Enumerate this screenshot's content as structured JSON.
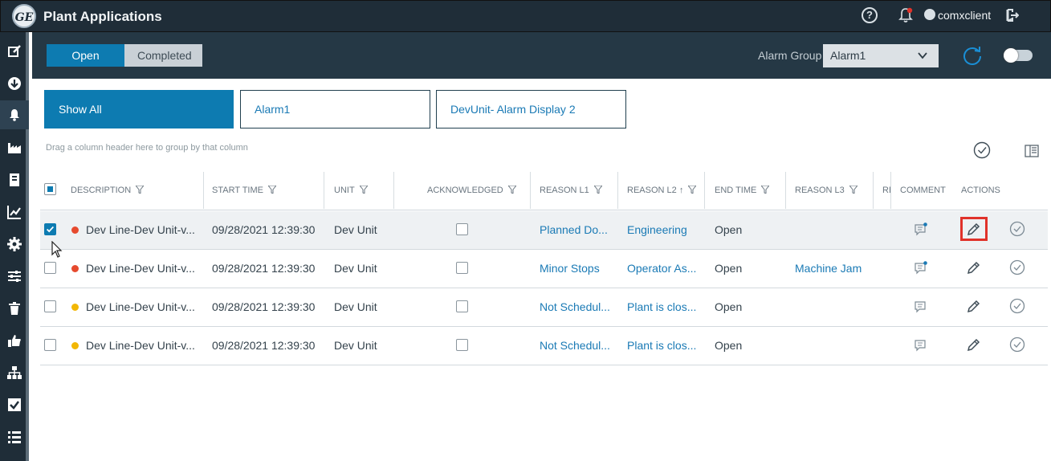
{
  "header": {
    "logo_text": "GE",
    "app_title": "Plant Applications",
    "help_glyph": "?",
    "user_name": "comxclient",
    "colors": {
      "bar": "#1f2d38",
      "accent": "#0d7bb1",
      "alert": "#e0322a"
    }
  },
  "sidebar": {
    "items": [
      {
        "icon": "edit-icon"
      },
      {
        "icon": "download-icon"
      },
      {
        "icon": "bell-icon"
      },
      {
        "icon": "factory-icon"
      },
      {
        "icon": "book-icon"
      },
      {
        "icon": "line-chart-icon"
      },
      {
        "icon": "gear-icon"
      },
      {
        "icon": "sliders-icon"
      },
      {
        "icon": "trash-icon"
      },
      {
        "icon": "thumbs-up-icon"
      },
      {
        "icon": "hierarchy-icon"
      },
      {
        "icon": "checkbox-icon"
      },
      {
        "icon": "list-icon"
      }
    ],
    "active": "bell-icon"
  },
  "toolbar": {
    "open_label": "Open",
    "completed_label": "Completed",
    "alarm_group_label": "Alarm Group",
    "alarm_group_value": "Alarm1"
  },
  "filters": {
    "show_all": "Show All",
    "alarm1": "Alarm1",
    "devunit": "DevUnit- Alarm Display 2"
  },
  "group_hint": "Drag a column header here to group by that column",
  "table": {
    "columns": {
      "description": "DESCRIPTION",
      "start_time": "START TIME",
      "unit": "UNIT",
      "acknowledged": "ACKNOWLEDGED",
      "reason_l1": "REASON L1",
      "reason_l2": "REASON L2",
      "reason_l2_sort": "↑",
      "end_time": "END TIME",
      "reason_l3": "REASON L3",
      "reason_l4": "RE",
      "comment": "COMMENT",
      "actions": "ACTIONS"
    },
    "rows": [
      {
        "selected": true,
        "priority_color": "#e64a2e",
        "description": "Dev Line-Dev Unit-v...",
        "start_time": "09/28/2021 12:39:30",
        "unit": "Dev Unit",
        "acknowledged": false,
        "reason_l1": "Planned Do...",
        "reason_l2": "Engineering",
        "end_time": "Open",
        "reason_l3": "",
        "has_comment": true
      },
      {
        "selected": false,
        "priority_color": "#e64a2e",
        "description": "Dev Line-Dev Unit-v...",
        "start_time": "09/28/2021 12:39:30",
        "unit": "Dev Unit",
        "acknowledged": false,
        "reason_l1": "Minor Stops",
        "reason_l2": "Operator As...",
        "end_time": "Open",
        "reason_l3": "Machine Jam",
        "has_comment": true
      },
      {
        "selected": false,
        "priority_color": "#f2b705",
        "description": "Dev Line-Dev Unit-v...",
        "start_time": "09/28/2021 12:39:30",
        "unit": "Dev Unit",
        "acknowledged": false,
        "reason_l1": "Not Schedul...",
        "reason_l2": "Plant is clos...",
        "end_time": "Open",
        "reason_l3": "",
        "has_comment": false
      },
      {
        "selected": false,
        "priority_color": "#f2b705",
        "description": "Dev Line-Dev Unit-v...",
        "start_time": "09/28/2021 12:39:30",
        "unit": "Dev Unit",
        "acknowledged": false,
        "reason_l1": "Not Schedul...",
        "reason_l2": "Plant is clos...",
        "end_time": "Open",
        "reason_l3": "",
        "has_comment": false
      }
    ]
  }
}
